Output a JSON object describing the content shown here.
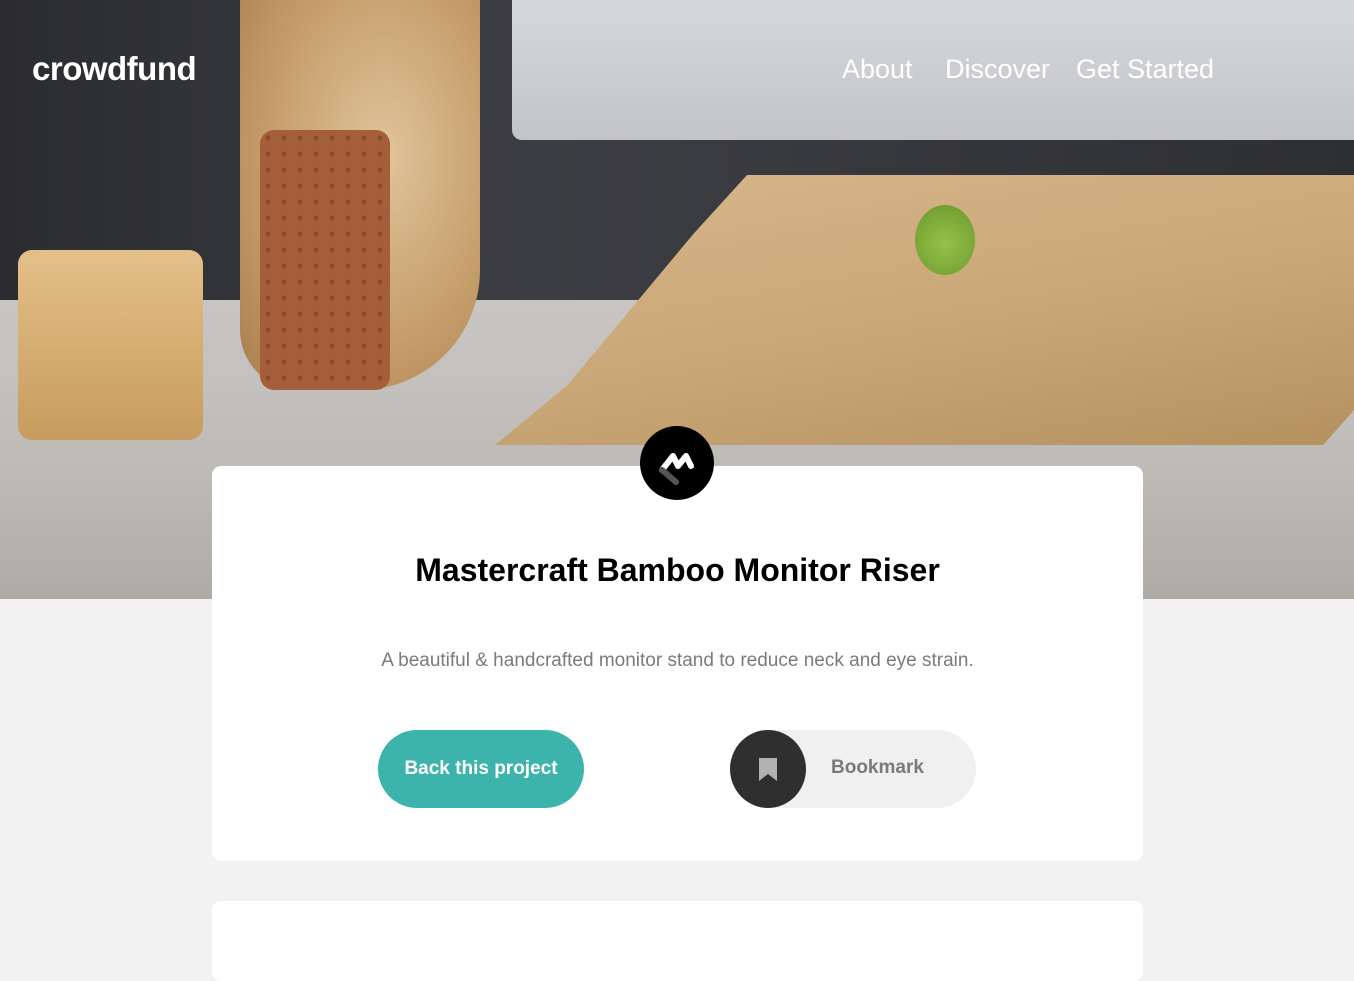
{
  "header": {
    "logo": "crowdfund",
    "nav": [
      {
        "label": "About"
      },
      {
        "label": "Discover"
      },
      {
        "label": "Get Started"
      }
    ]
  },
  "project": {
    "brand_icon": "mastercraft-logo-icon",
    "title": "Mastercraft Bamboo Monitor Riser",
    "description": "A beautiful & handcrafted monitor stand to reduce neck and eye strain.",
    "back_label": "Back this project",
    "bookmark_label": "Bookmark",
    "bookmark_icon": "bookmark-icon"
  },
  "colors": {
    "accent": "#3cb4ac",
    "dark": "#2f2f2f",
    "muted_text": "#7a7a7a",
    "page_bg": "#f2f2f2"
  }
}
